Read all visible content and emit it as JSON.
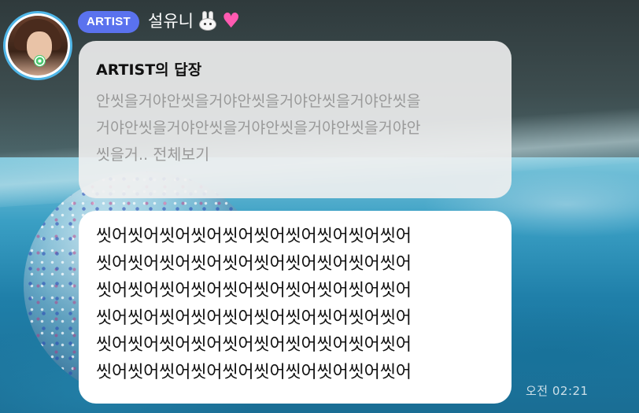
{
  "header": {
    "badge": "ARTIST",
    "name": "설유니",
    "name_icons": [
      "rabbit-face-icon",
      "pink-heart-icon"
    ]
  },
  "reply": {
    "title": "ARTIST의 답장",
    "lines": [
      "안씻을거야안씻을거야안씻을거야안씻을거야안씻을",
      "거야안씻을거야안씻을거야안씻을거야안씻을거야안",
      "씻을거.."
    ],
    "view_all": "전체보기"
  },
  "message": {
    "lines": [
      "씻어씻어씻어씻어씻어씻어씻어씻어씻어씻어",
      "씻어씻어씻어씻어씻어씻어씻어씻어씻어씻어",
      "씻어씻어씻어씻어씻어씻어씻어씻어씻어씻어",
      "씻어씻어씻어씻어씻어씻어씻어씻어씻어씻어",
      "씻어씻어씻어씻어씻어씻어씻어씻어씻어씻어",
      "씻어씻어씻어씻어씻어씻어씻어씻어씻어씻어"
    ]
  },
  "timestamp": "오전 02:21",
  "colors": {
    "badge": "#5a72ee",
    "avatar_ring": "#4fb6e8",
    "heart": "#ff5ab1"
  }
}
